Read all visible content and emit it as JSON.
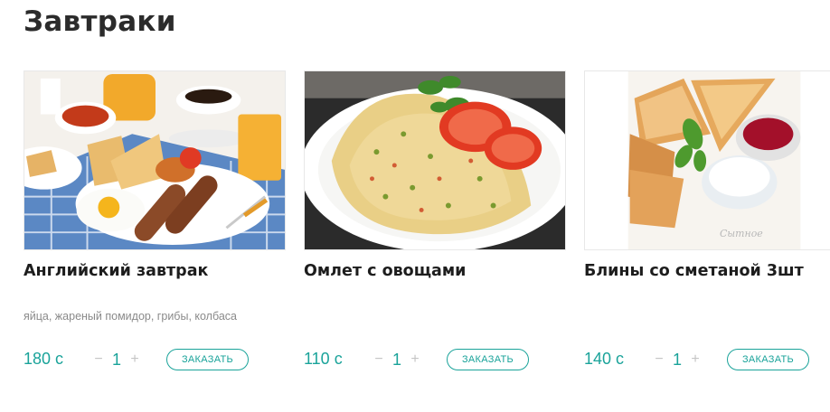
{
  "section": {
    "title": "Завтраки"
  },
  "items": [
    {
      "title": "Английский завтрак",
      "description": "яйца, жареный помидор, грибы, колбаса",
      "price": "180 с",
      "qty": "1",
      "order_label": "ЗАКАЗАТЬ"
    },
    {
      "title": "Омлет с овощами",
      "description": "",
      "price": "110 с",
      "qty": "1",
      "order_label": "ЗАКАЗАТЬ"
    },
    {
      "title": "Блины со сметаной 3шт",
      "description": "",
      "price": "140 с",
      "qty": "1",
      "order_label": "ЗАКАЗАТЬ"
    }
  ],
  "controls": {
    "minus": "−",
    "plus": "+"
  },
  "colors": {
    "accent": "#1aa39a",
    "title": "#2b2b2b",
    "muted": "#8a8a8a"
  },
  "photo_watermark": "Сытное"
}
